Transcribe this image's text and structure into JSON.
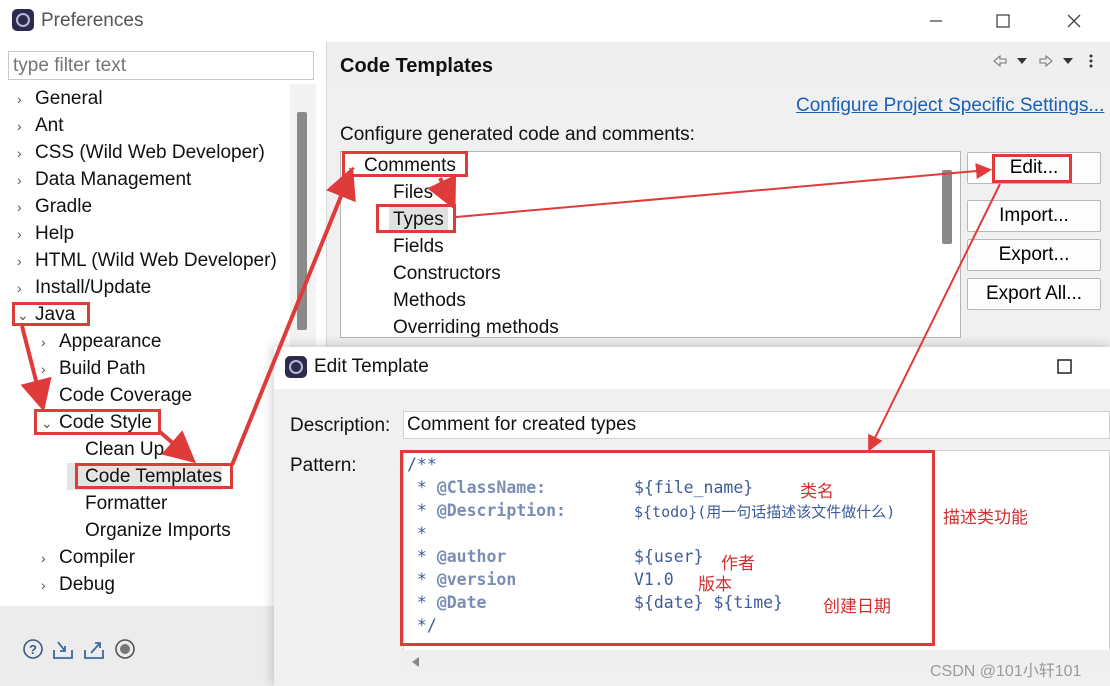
{
  "window": {
    "title": "Preferences",
    "minimize_icon": "minimize-icon",
    "maximize_icon": "maximize-icon",
    "close_icon": "close-icon"
  },
  "left_panel": {
    "filter_placeholder": "type filter text",
    "tree": [
      {
        "label": "General",
        "expander": "›"
      },
      {
        "label": "Ant",
        "expander": "›"
      },
      {
        "label": "CSS (Wild Web Developer)",
        "expander": "›"
      },
      {
        "label": "Data Management",
        "expander": "›"
      },
      {
        "label": "Gradle",
        "expander": "›"
      },
      {
        "label": "Help",
        "expander": "›"
      },
      {
        "label": "HTML (Wild Web Developer)",
        "expander": "›"
      },
      {
        "label": "Install/Update",
        "expander": "›"
      },
      {
        "label": "Java",
        "expander": "⌄"
      },
      {
        "label": "Appearance",
        "expander": "›"
      },
      {
        "label": "Build Path",
        "expander": "›"
      },
      {
        "label": "Code Coverage",
        "expander": ""
      },
      {
        "label": "Code Style",
        "expander": "⌄"
      },
      {
        "label": "Clean Up",
        "expander": ""
      },
      {
        "label": "Code Templates",
        "expander": ""
      },
      {
        "label": "Formatter",
        "expander": ""
      },
      {
        "label": "Organize Imports",
        "expander": ""
      },
      {
        "label": "Compiler",
        "expander": "›"
      },
      {
        "label": "Debug",
        "expander": "›"
      }
    ],
    "bottom_icons": [
      "help-icon",
      "import-icon",
      "export-icon",
      "oomph-icon"
    ]
  },
  "right_panel": {
    "title": "Code Templates",
    "nav_icons": [
      "back-icon",
      "forward-icon",
      "menu-icon"
    ],
    "project_link": "Configure Project Specific Settings...",
    "configure_label": "Configure generated code and comments:",
    "tree_root": {
      "label": "Comments",
      "expander": "⌄"
    },
    "tree_children": [
      "Files",
      "Types",
      "Fields",
      "Constructors",
      "Methods",
      "Overriding methods"
    ],
    "buttons": {
      "edit": "Edit...",
      "import": "Import...",
      "export": "Export...",
      "export_all": "Export All..."
    }
  },
  "edit_dialog": {
    "title": "Edit Template",
    "description_label": "Description:",
    "description_value": "Comment for created types",
    "pattern_label": "Pattern:",
    "pattern_lines": [
      {
        "prefix": "/**",
        "tag": "",
        "value": ""
      },
      {
        "prefix": " * ",
        "tag": "@ClassName:",
        "value": "${file_name}"
      },
      {
        "prefix": " * ",
        "tag": "@Description:",
        "value": "${todo}(用一句话描述该文件做什么)"
      },
      {
        "prefix": " *",
        "tag": "",
        "value": ""
      },
      {
        "prefix": " * ",
        "tag": "@author",
        "value": "${user}"
      },
      {
        "prefix": " * ",
        "tag": "@version",
        "value": "V1.0"
      },
      {
        "prefix": " * ",
        "tag": "@Date",
        "value": "${date} ${time}"
      },
      {
        "prefix": " */",
        "tag": "",
        "value": ""
      }
    ],
    "annotations": {
      "class_name": "类名",
      "description": "描述类功能",
      "author": "作者",
      "version": "版本",
      "date": "创建日期"
    }
  },
  "watermark": "CSDN @101小轩101",
  "colors": {
    "highlight": "#e03b3b",
    "link": "#1a5fb4",
    "code": "#3e5b9a",
    "code_tag": "#7a8db3",
    "annotation": "#d03030"
  }
}
